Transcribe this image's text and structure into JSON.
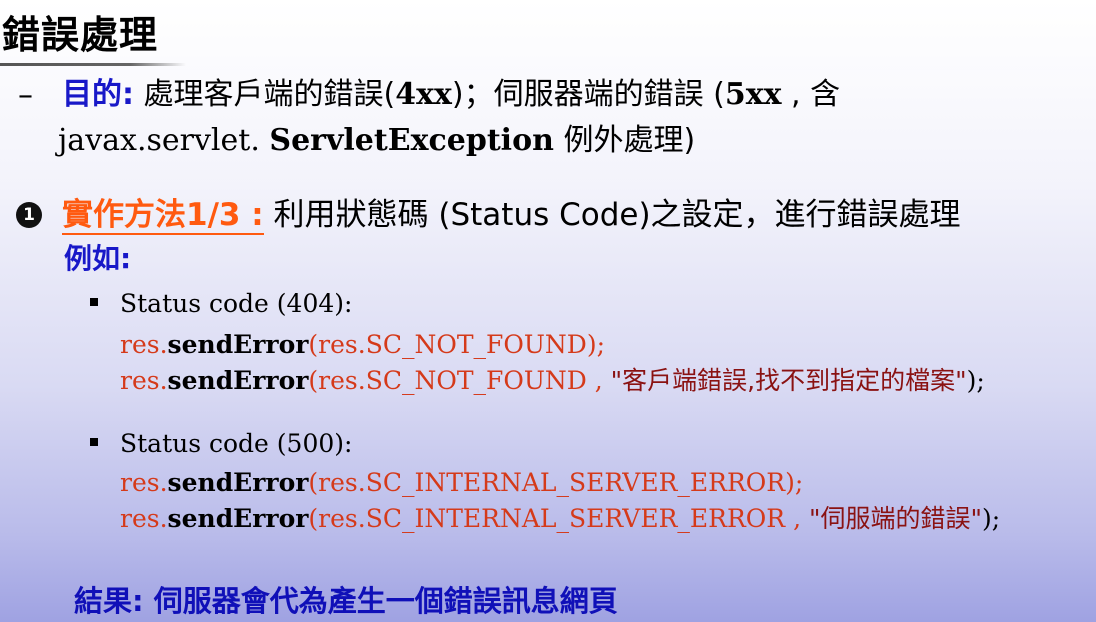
{
  "title": "錯誤處理",
  "purpose": {
    "dash": "–",
    "label": "目的:",
    "text_a": " 處理客戶端的錯誤(",
    "code_4xx": "4xx",
    "text_b": ")；伺服器端的錯誤 (",
    "code_5xx": "5xx",
    "text_c": " , 含",
    "line2_a": "javax.servlet. ",
    "line2_bold": "ServletException",
    "line2_b": " 例外處理)"
  },
  "impl": {
    "bullet": "1",
    "label": "實作方法1/3 :",
    "text": " 利用狀態碼 (Status Code)之設定，進行錯誤處理"
  },
  "example_label": "例如:",
  "examples": [
    {
      "heading": "Status code (404):",
      "line1": {
        "obj": "res.",
        "method": "sendError",
        "args": "(res.SC_NOT_FOUND);"
      },
      "line2": {
        "obj": "res.",
        "method": "sendError",
        "args": "(res.SC_NOT_FOUND , ",
        "message": "\"客戶端錯誤,找不到指定的檔案\"",
        "end": ");"
      }
    },
    {
      "heading": "Status code (500):",
      "line1": {
        "obj": "res.",
        "method": "sendError",
        "args": "(res.SC_INTERNAL_SERVER_ERROR);"
      },
      "line2": {
        "obj": "res.",
        "method": "sendError",
        "args": "(res.SC_INTERNAL_SERVER_ERROR , ",
        "message": "\"伺服端的錯誤\"",
        "end": ");"
      }
    }
  ],
  "result": "結果: 伺服器會代為產生一個錯誤訊息網頁"
}
